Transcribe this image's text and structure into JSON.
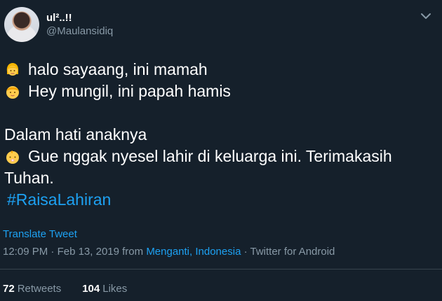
{
  "user": {
    "display_name": "ul²..!!",
    "handle": "@Maulansidiq",
    "avatar": "avatar-photo"
  },
  "tweet": {
    "lines": [
      {
        "emoji": "woman-emoji",
        "text": "halo sayaang, ini mamah"
      },
      {
        "emoji": "man-emoji",
        "text": "Hey mungil, ini papah hamis"
      },
      {
        "text": "Dalam hati anaknya"
      },
      {
        "emoji": "baby-emoji",
        "text": "Gue nggak nyesel lahir di keluarga ini. Terimakasih"
      },
      {
        "text": "Tuhan."
      }
    ],
    "hashtag": "#RaisaLahiran",
    "translate_label": "Translate Tweet",
    "time": "12:09 PM",
    "separator": "·",
    "date": "Feb 13, 2019",
    "from_label": "from",
    "location": "Menganti, Indonesia",
    "client": "Twitter for Android"
  },
  "stats": {
    "retweets_count": "72",
    "retweets_label": "Retweets",
    "likes_count": "104",
    "likes_label": "Likes"
  },
  "icons": {
    "more_menu": "chevron-down-icon"
  },
  "colors": {
    "background": "#15202b",
    "text": "#ffffff",
    "secondary": "#8899a6",
    "accent": "#1da1f2",
    "divider": "#38444d"
  }
}
